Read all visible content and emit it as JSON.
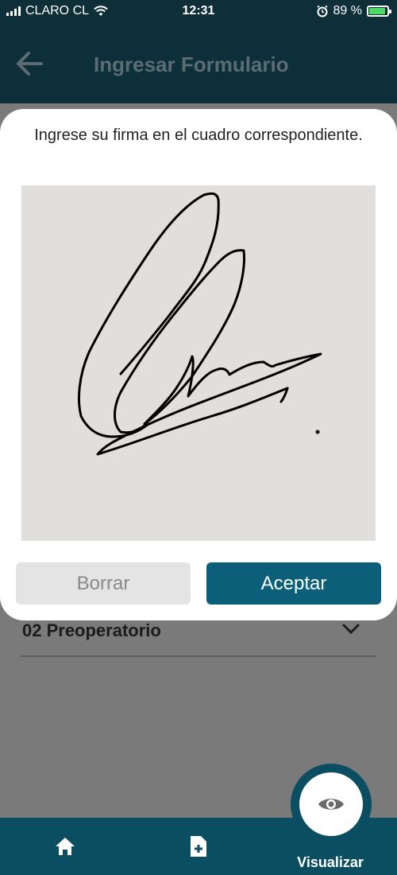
{
  "status_bar": {
    "carrier": "CLARO CL",
    "time": "12:31",
    "battery_percent": "89 %",
    "battery_level": 0.89,
    "icons": [
      "signal-icon",
      "wifi-icon",
      "alarm-icon",
      "battery-charging-icon"
    ]
  },
  "header": {
    "title": "Ingresar Formulario",
    "back_icon": "arrow-left-icon"
  },
  "section": {
    "title": "02 Preoperatorio",
    "toggle_icon": "chevron-down-icon"
  },
  "modal": {
    "instruction": "Ingrese su firma en el cuadro correspondiente.",
    "clear_label": "Borrar",
    "accept_label": "Aceptar"
  },
  "bottom_nav": {
    "items": [
      {
        "icon": "home-icon"
      },
      {
        "icon": "add-document-icon"
      }
    ],
    "fab": {
      "icon": "eye-icon",
      "label": "Visualizar"
    }
  },
  "colors": {
    "header_bg": "#0c2f3a",
    "accent": "#0b5f78",
    "nav_bg": "#0b4d61",
    "pad_bg": "#e0dfdd"
  }
}
